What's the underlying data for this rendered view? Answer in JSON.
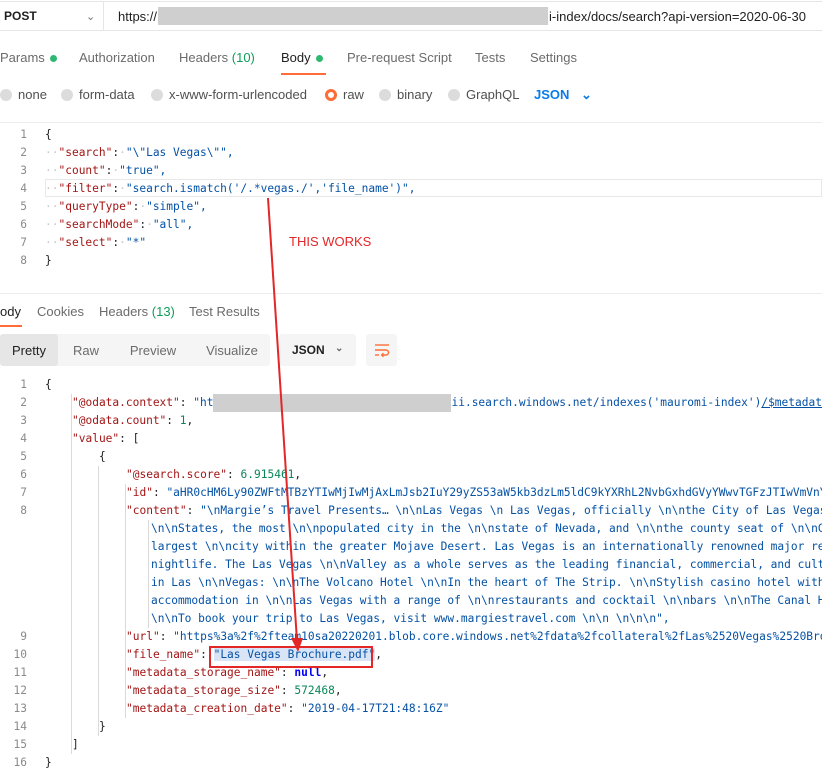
{
  "request": {
    "method": "POST",
    "url_prefix": "https://",
    "url_suffix": "i-index/docs/search?api-version=2020-06-30",
    "tabs": [
      {
        "label": "Params",
        "count": "",
        "dot": true
      },
      {
        "label": "Authorization",
        "count": "",
        "dot": false
      },
      {
        "label": "Headers",
        "count": "(10)",
        "dot": false
      },
      {
        "label": "Body",
        "count": "",
        "dot": true
      },
      {
        "label": "Pre-request Script",
        "count": "",
        "dot": false
      },
      {
        "label": "Tests",
        "count": "",
        "dot": false
      },
      {
        "label": "Settings",
        "count": "",
        "dot": false
      }
    ],
    "active_tab": "Body",
    "body_types": [
      "none",
      "form-data",
      "x-www-form-urlencoded",
      "raw",
      "binary",
      "GraphQL"
    ],
    "selected_body_type": "raw",
    "format": "JSON",
    "body_lines": [
      {
        "n": "1",
        "text": "{"
      },
      {
        "n": "2",
        "key": "\"search\"",
        "value": "\"\\\"Las Vegas\\\"\","
      },
      {
        "n": "3",
        "key": "\"count\"",
        "value": "\"true\","
      },
      {
        "n": "4",
        "key": "\"filter\"",
        "value": "\"search.ismatch('/.*vegas./','file_name')\","
      },
      {
        "n": "5",
        "key": "\"queryType\"",
        "value": "\"simple\","
      },
      {
        "n": "6",
        "key": "\"searchMode\"",
        "value": "\"all\","
      },
      {
        "n": "7",
        "key": "\"select\"",
        "value": "\"*\""
      },
      {
        "n": "8",
        "text": "}"
      }
    ]
  },
  "annotation": "THIS WORKS",
  "response": {
    "tabs": [
      {
        "label": "ody",
        "count": ""
      },
      {
        "label": "Cookies",
        "count": ""
      },
      {
        "label": "Headers",
        "count": "(13)"
      },
      {
        "label": "Test Results",
        "count": ""
      }
    ],
    "views": [
      "Pretty",
      "Raw",
      "Preview",
      "Visualize"
    ],
    "active_view": "Pretty",
    "format": "JSON",
    "lines": {
      "l1": "{",
      "l2_key": "\"@odata.context\"",
      "l2_val_start": "\"ht",
      "l2_val_mid": "ii.search.windows.net/indexes('mauromi-index')",
      "l2_val_link": "/$metadata#docs",
      "l3_key": "\"@odata.count\"",
      "l3_val": "1",
      "l4_key": "\"value\"",
      "l4_val": "[",
      "l5": "{",
      "l6_key": "\"@search.score\"",
      "l6_val": "6.915461",
      "l7_key": "\"id\"",
      "l7_val": "\"aHR0cHM6Ly90ZWFtMTBzYTIwMjIwMjAxLmJsb2IuY29yZS53aW5kb3dzLm5ldC9kYXRhL2NvbGxhdGVyYWwvTGFzJTIwVmVnYXM",
      "l8_key": "\"content\"",
      "l8_val": "\"\\nMargie’s Travel Presents… \\n\\nLas Vegas \\n Las Vegas, officially \\n\\nthe City of Las Vegas \\",
      "l8_c1": "\\n\\nStates, the most \\n\\npopulated city in the \\n\\nstate of Nevada, and \\n\\nthe county seat of \\n\\nCla",
      "l8_c2": "largest \\n\\ncity within the greater Mojave Desert. Las Vegas is an internationally renowned major reso",
      "l8_c3": "nightlife. The Las Vegas \\n\\nValley as a whole serves as the leading financial, commercial, and cultur",
      "l8_c4": "in Las \\n\\nVegas: \\n\\nThe Volcano Hotel \\n\\nIn the heart of The Strip. \\n\\nStylish casino hotel with \\",
      "l8_c5": "accommodation in \\n\\nLas Vegas with a range of \\n\\nrestaurants and cocktail \\n\\nbars \\n\\nThe Canal Hot",
      "l8_c6": "\\n\\nTo book your trip to Las Vegas, visit www.margiestravel.com \\n\\n \\n\\n\\n\",",
      "l9_key": "\"url\"",
      "l9_val": "\"https%3a%2f%2fteam10sa20220201.blob.core.windows.net%2fdata%2fcollateral%2fLas%2520Vegas%2520Broch",
      "l10_key": "\"file_name\"",
      "l10_val": "\"Las Vegas Brochure.pdf\"",
      "l11_key": "\"metadata_storage_name\"",
      "l11_val": "null",
      "l12_key": "\"metadata_storage_size\"",
      "l12_val": "572468",
      "l13_key": "\"metadata_creation_date\"",
      "l13_val": "\"2019-04-17T21:48:16Z\"",
      "l14": "}",
      "l15": "]",
      "l16": "}"
    }
  },
  "colors": {
    "accent": "#ff6c37",
    "annotation": "#e32727",
    "link": "#097bed",
    "success": "#0f9d58"
  }
}
